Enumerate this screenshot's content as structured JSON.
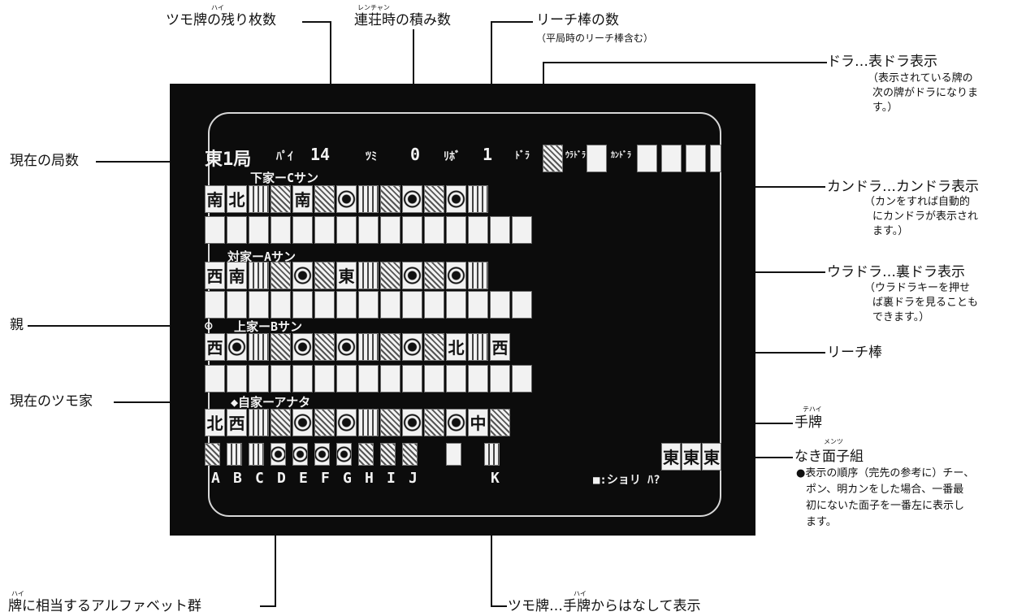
{
  "labels": {
    "tsumo_remaining": "ツモ牌の残り枚数",
    "tsumo_ruby": "ハイ",
    "renchan": "連荘時の積み数",
    "renchan_ruby": "レンチャン",
    "riichi_count": "リーチ棒の数",
    "riichi_count_note": "（平局時のリーチ棒含む）",
    "dora": "ドラ…表ドラ表示",
    "dora_note_1": "（表示されている牌の",
    "dora_note_2": "次の牌がドラになりま",
    "dora_note_3": "す。）",
    "kyoku": "現在の局数",
    "kandora": "カンドラ…カンドラ表示",
    "kandora_note_1": "（カンをすれば自動的",
    "kandora_note_2": "にカンドラが表示され",
    "kandora_note_3": "ます。）",
    "uradora": "ウラドラ…裏ドラ表示",
    "uradora_note_1": "（ウラドラキーを押せ",
    "uradora_note_2": "ば裏ドラを見ることも",
    "uradora_note_3": "できます。）",
    "oya": "親",
    "riichi_bou": "リーチ棒",
    "current_tsumo": "現在のツモ家",
    "tehai": "手牌",
    "tehai_ruby": "テハイ",
    "naki": "なき面子組",
    "naki_ruby": "メンツ",
    "naki_note_1": "●表示の順序（完先の参考に）チー、",
    "naki_note_2": "ポン、明カンをした場合、一番最",
    "naki_note_3": "初にないた面子を一番左に表示し",
    "naki_note_4": "ます。",
    "alphabet": "牌に相当するアルファベット群",
    "alphabet_ruby": "ハイ",
    "tsumo_hai": "ツモ牌…手牌からはなして表示",
    "tsumo_hai_ruby": "ハイ"
  },
  "screen": {
    "status_kyoku": "東1局",
    "status_pai": "ﾊﾟｲ",
    "status_pai_val": "14",
    "status_tsumi": "ﾂﾐ",
    "status_tsumi_val": "0",
    "status_riichi": "ﾘﾎﾞ",
    "status_riichi_val": "1",
    "status_dora": "ﾄﾞﾗ",
    "status_uradora": "ｳﾗﾄﾞﾗ",
    "status_kandora": "ｶﾝﾄﾞﾗ",
    "player_shimo": "下家ーCサン",
    "player_toi": "対家ーAサン",
    "player_kami": "上家ーBサン",
    "player_self": "◆自家ーアナタ",
    "oya_marker": "⊙",
    "letters": [
      "A",
      "B",
      "C",
      "D",
      "E",
      "F",
      "G",
      "H",
      "I",
      "J",
      "K"
    ],
    "prompt": "■:ショリ ﾊ?",
    "shimo_tiles": [
      "南",
      "北",
      "",
      "",
      "南",
      "",
      "",
      "",
      "",
      "",
      "",
      "",
      ""
    ],
    "toi_tiles": [
      "西",
      "南",
      "",
      "",
      "",
      "",
      "東",
      "",
      "",
      "",
      "",
      "",
      ""
    ],
    "kami_tiles": [
      "西",
      "",
      "",
      "",
      "",
      "",
      "",
      "",
      "",
      "",
      "",
      "北",
      "",
      "西"
    ],
    "self_tiles": [
      "北",
      "西",
      "",
      "",
      "",
      "",
      "",
      "",
      "",
      "",
      "",
      "",
      "中",
      ""
    ],
    "naki_tiles": [
      "東",
      "東",
      "東"
    ]
  }
}
